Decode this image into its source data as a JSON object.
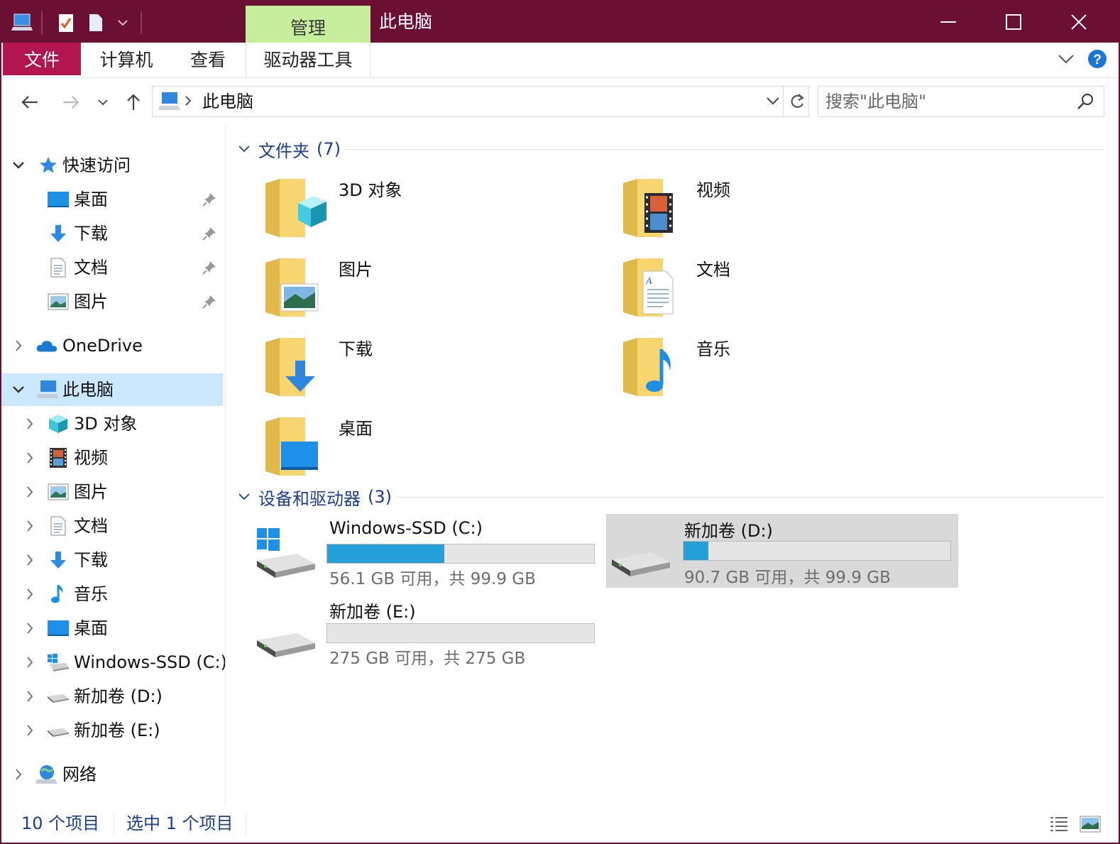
{
  "window": {
    "title": "此电脑",
    "context_tab": "管理"
  },
  "ribbon": {
    "tabs": [
      "文件",
      "计算机",
      "查看",
      "驱动器工具"
    ]
  },
  "address": {
    "crumb": "此电脑",
    "search_placeholder": "搜索\"此电脑\""
  },
  "nav": {
    "quick_access": "快速访问",
    "quick_items": [
      "桌面",
      "下载",
      "文档",
      "图片"
    ],
    "onedrive": "OneDrive",
    "this_pc": "此电脑",
    "pc_items": [
      "3D 对象",
      "视频",
      "图片",
      "文档",
      "下载",
      "音乐",
      "桌面",
      "Windows-SSD (C:)",
      "新加卷 (D:)",
      "新加卷 (E:)"
    ],
    "network": "网络"
  },
  "folders_group": {
    "title": "文件夹",
    "count": "(7)",
    "items": [
      "3D 对象",
      "视频",
      "图片",
      "文档",
      "下载",
      "音乐",
      "桌面"
    ]
  },
  "drives_group": {
    "title": "设备和驱动器",
    "count": "(3)",
    "drives": [
      {
        "name": "Windows-SSD (C:)",
        "free": "56.1 GB 可用，共 99.9 GB",
        "used_fraction": 0.438
      },
      {
        "name": "新加卷 (D:)",
        "free": "90.7 GB 可用，共 99.9 GB",
        "used_fraction": 0.092
      },
      {
        "name": "新加卷 (E:)",
        "free": "275 GB 可用，共 275 GB",
        "used_fraction": 0.0
      }
    ]
  },
  "status": {
    "count": "10 个项目",
    "selected": "选中 1 个项目"
  },
  "colors": {
    "titlebar": "#6b0f33",
    "file_tab": "#b3164e",
    "manage_tab": "#c7ee9c",
    "selection": "#cce8ff",
    "drive_bar": "#26a0da",
    "group_text": "#1e3f8f"
  }
}
